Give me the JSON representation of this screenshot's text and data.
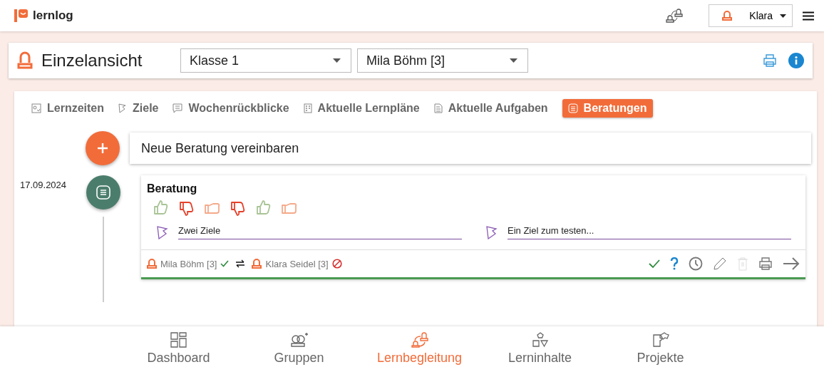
{
  "app": {
    "name": "lernlog"
  },
  "user_menu": {
    "name": "Klara"
  },
  "view": {
    "title": "Einzelansicht",
    "selects": [
      {
        "value": "Klasse 1"
      },
      {
        "value": "Mila Böhm [3]"
      }
    ]
  },
  "tabs": [
    {
      "label": "Lernzeiten",
      "selected": false
    },
    {
      "label": "Ziele",
      "selected": false
    },
    {
      "label": "Wochenrückblicke",
      "selected": false
    },
    {
      "label": "Aktuelle Lernpläne",
      "selected": false
    },
    {
      "label": "Aktuelle Aufgaben",
      "selected": false
    },
    {
      "label": "Beratungen",
      "selected": true
    }
  ],
  "new_entry": {
    "label": "Neue Beratung vereinbaren"
  },
  "entries": [
    {
      "date": "17.09.2024",
      "title": "Beratung",
      "ratings": [
        {
          "kind": "up"
        },
        {
          "kind": "down"
        },
        {
          "kind": "neutral"
        },
        {
          "kind": "down"
        },
        {
          "kind": "up"
        },
        {
          "kind": "neutral"
        }
      ],
      "goals": [
        {
          "text": "Zwei Ziele"
        },
        {
          "text": "Ein Ziel zum testen..."
        }
      ],
      "participants": [
        {
          "name": "Mila Böhm [3]",
          "accepted": true
        },
        {
          "name": "Klara Seidel [3]",
          "accepted": false
        }
      ],
      "actions": [
        {
          "kind": "accept",
          "disabled": false
        },
        {
          "kind": "question",
          "disabled": false
        },
        {
          "kind": "time",
          "disabled": false
        },
        {
          "kind": "edit",
          "disabled": false
        },
        {
          "kind": "delete",
          "disabled": true
        },
        {
          "kind": "print",
          "disabled": false
        },
        {
          "kind": "forward",
          "disabled": false
        }
      ]
    }
  ],
  "nav": [
    {
      "label": "Dashboard",
      "selected": false
    },
    {
      "label": "Gruppen",
      "selected": false
    },
    {
      "label": "Lernbegleitung",
      "selected": true
    },
    {
      "label": "Lerninhalte",
      "selected": false
    },
    {
      "label": "Projekte",
      "selected": false
    }
  ]
}
